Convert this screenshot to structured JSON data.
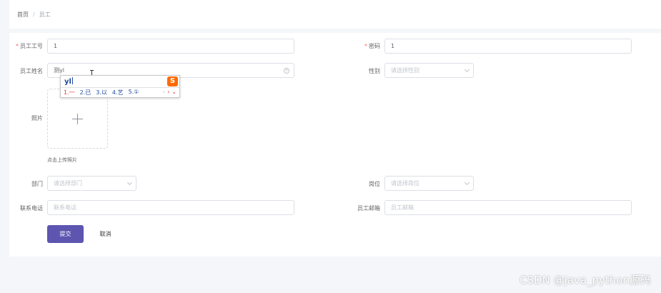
{
  "breadcrumb": {
    "home": "首页",
    "separator": "/",
    "current": "员工"
  },
  "form": {
    "employee_no": {
      "label": "员工工号",
      "required_mark": "*",
      "value": "1"
    },
    "password": {
      "label": "密码",
      "required_mark": "*",
      "value": "1"
    },
    "employee_name": {
      "label": "员工姓名",
      "value": "测yl",
      "clear_icon": "circle-x-icon"
    },
    "gender": {
      "label": "性别",
      "placeholder": "请选择性别"
    },
    "photo": {
      "label": "照片",
      "upload_icon": "plus-icon",
      "tip": "点击上传照片"
    },
    "department": {
      "label": "部门",
      "placeholder": "请选择部门"
    },
    "position": {
      "label": "岗位",
      "placeholder": "请选择岗位"
    },
    "phone": {
      "label": "联系电话",
      "placeholder": "联系电话"
    },
    "email": {
      "label": "员工邮箱",
      "placeholder": "员工邮箱"
    },
    "submit_label": "提交",
    "cancel_label": "取消"
  },
  "ime": {
    "composition": "yl",
    "logo": "S",
    "candidates": [
      "1.一",
      "2.已",
      "3.以",
      "4.艺",
      "5.①"
    ],
    "prev": "‹",
    "next": "›",
    "expand": "⌄"
  },
  "watermark": "CSDN @java_python源码",
  "colors": {
    "primary": "#5d55b0",
    "required": "#f56c6c",
    "page_bg": "#f5f6fa",
    "ime_accent": "#ff6a00"
  }
}
